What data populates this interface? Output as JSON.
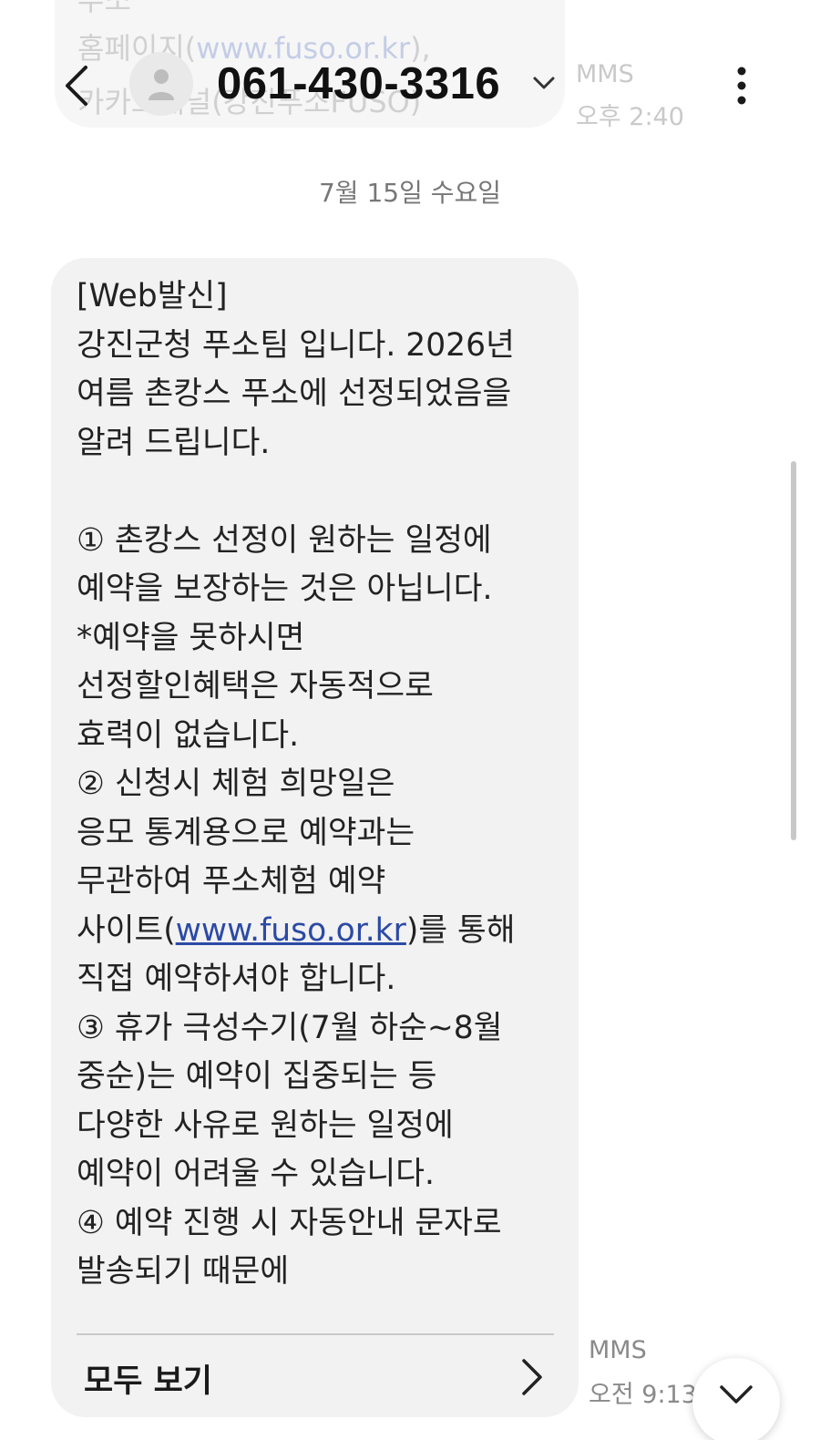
{
  "prev_message": {
    "lines": [
      "푸소",
      "홈페이지(",
      "www.fuso.or.kr",
      "),",
      "카카오채널(강진푸소FUSO)"
    ],
    "meta_type": "MMS",
    "meta_time": "오후 2:40"
  },
  "header": {
    "back_icon": "chevron-left-icon",
    "avatar_icon": "person-icon",
    "title": "061-430-3316",
    "dropdown_icon": "chevron-down-icon",
    "more_icon": "more-vertical-icon"
  },
  "date_separator": "7월 15일 수요일",
  "message": {
    "lines": [
      "[Web발신]",
      "강진군청 푸소팀 입니다. 2026년",
      "여름 촌캉스 푸소에 선정되었음을",
      "알려 드립니다.",
      "",
      "① 촌캉스 선정이 원하는 일정에",
      "예약을 보장하는 것은 아닙니다.",
      "*예약을 못하시면",
      "선정할인혜택은 자동적으로",
      "효력이 없습니다.",
      "② 신청시 체험 희망일은",
      "응모 통계용으로 예약과는",
      "무관하여 푸소체험 예약"
    ],
    "link_prefix": "사이트(",
    "link": "www.fuso.or.kr",
    "link_suffix": ")를 통해",
    "lines_after": [
      "직접 예약하셔야 합니다.",
      "③ 휴가 극성수기(7월 하순~8월",
      "중순)는 예약이 집중되는 등",
      "다양한 사유로 원하는 일정에",
      "예약이 어려울 수 있습니다.",
      "④ 예약 진행 시 자동안내 문자로",
      "발송되기 때문에"
    ],
    "view_all_label": "모두 보기",
    "meta_type": "MMS",
    "meta_time": "오전 9:13"
  },
  "scroll_down_icon": "chevron-down-icon",
  "colors": {
    "bubble": "#f2f2f2",
    "link": "#2b4aa6",
    "meta": "#8a8a8a",
    "title": "#111111"
  }
}
